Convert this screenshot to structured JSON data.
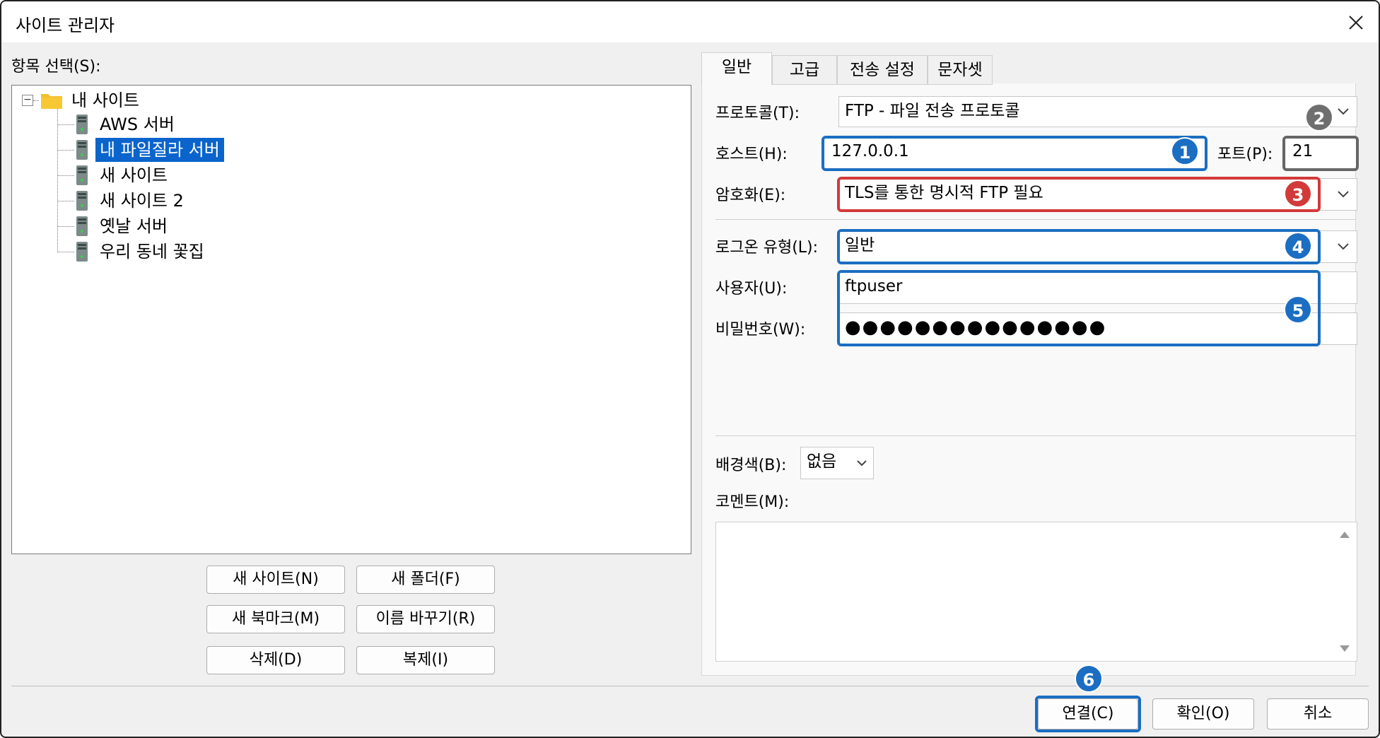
{
  "window": {
    "title": "사이트 관리자"
  },
  "left": {
    "select_label": "항목 선택(S):",
    "root": "내 사이트",
    "sites": [
      {
        "label": "AWS 서버",
        "selected": false
      },
      {
        "label": "내 파일질라 서버",
        "selected": true
      },
      {
        "label": "새 사이트",
        "selected": false
      },
      {
        "label": "새 사이트 2",
        "selected": false
      },
      {
        "label": "옛날 서버",
        "selected": false
      },
      {
        "label": "우리 동네 꽃집",
        "selected": false
      }
    ],
    "buttons": {
      "new_site": "새 사이트(N)",
      "new_folder": "새 폴더(F)",
      "new_bookmark": "새 북마크(M)",
      "rename": "이름 바꾸기(R)",
      "delete": "삭제(D)",
      "duplicate": "복제(I)"
    }
  },
  "tabs": [
    "일반",
    "고급",
    "전송 설정",
    "문자셋"
  ],
  "general": {
    "protocol_label": "프로토콜(T):",
    "protocol_value": "FTP - 파일 전송 프로토콜",
    "host_label": "호스트(H):",
    "host_value": "127.0.0.1",
    "port_label": "포트(P):",
    "port_value": "21",
    "encryption_label": "암호화(E):",
    "encryption_value": "TLS를 통한 명시적 FTP 필요",
    "logon_label": "로그온 유형(L):",
    "logon_value": "일반",
    "user_label": "사용자(U):",
    "user_value": "ftpuser",
    "password_label": "비밀번호(W):",
    "password_value": "●●●●●●●●●●●●●●●",
    "bgcolor_label": "배경색(B):",
    "bgcolor_value": "없음",
    "comment_label": "코멘트(M):"
  },
  "badges": [
    "1",
    "2",
    "3",
    "4",
    "5",
    "6"
  ],
  "footer": {
    "connect": "연결(C)",
    "ok": "확인(O)",
    "cancel": "취소"
  },
  "colors": {
    "accent": "#1b6ec2",
    "highlight_red": "#d23a3a",
    "highlight_gray": "#6f6f6f",
    "selection": "#0a64cc"
  }
}
